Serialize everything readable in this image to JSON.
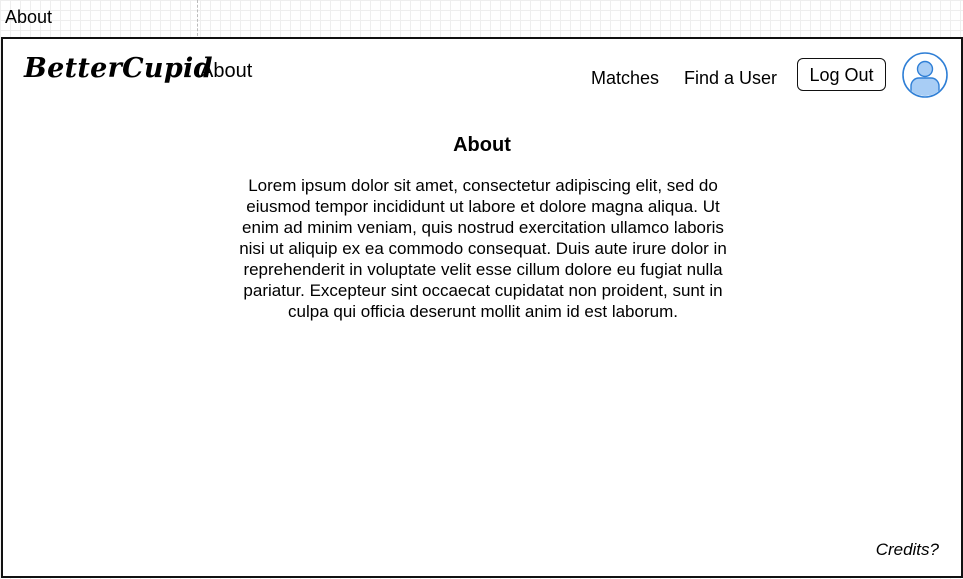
{
  "page_label": "About",
  "navbar": {
    "brand": "BetterCupid",
    "about_link": "About",
    "matches_link": "Matches",
    "find_user_link": "Find a User",
    "logout_label": "Log Out",
    "avatar_icon": "user-avatar-icon"
  },
  "main": {
    "title": "About",
    "body": "Lorem ipsum dolor sit amet, consectetur adipiscing elit, sed do eiusmod tempor incididunt ut labore et dolore magna aliqua. Ut enim ad minim veniam, quis nostrud exercitation ullamco laboris nisi ut aliquip ex ea commodo consequat. Duis aute irure dolor in reprehenderit in voluptate velit esse cillum dolore eu fugiat nulla pariatur. Excepteur sint occaecat cupidatat non proident, sunt in culpa qui officia deserunt mollit anim id est laborum."
  },
  "footer": {
    "credits_link": "Credits?"
  },
  "colors": {
    "avatar_fill": "#a8cdf5",
    "avatar_stroke": "#2f7fd6",
    "frame_border": "#111111"
  }
}
